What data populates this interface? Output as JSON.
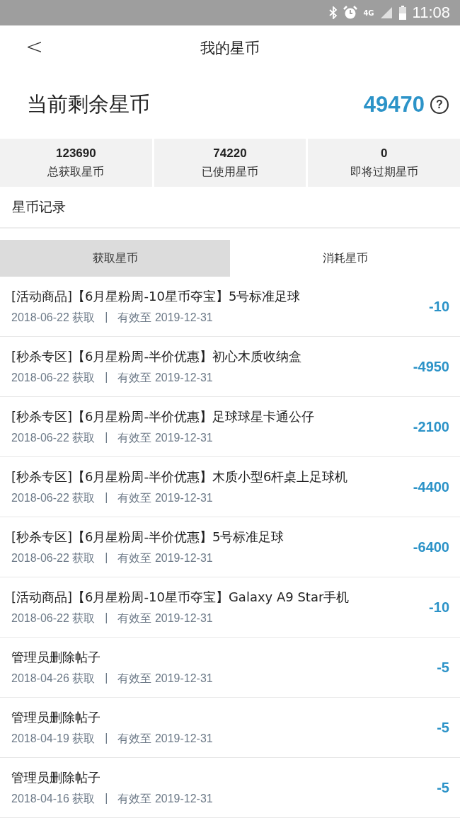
{
  "status_bar": {
    "network": "4G",
    "time": "11:08"
  },
  "header": {
    "back": "<",
    "title": "我的星币"
  },
  "balance": {
    "label": "当前剩余星币",
    "value": "49470",
    "help": "?"
  },
  "stats": [
    {
      "value": "123690",
      "label": "总获取星币"
    },
    {
      "value": "74220",
      "label": "已使用星币"
    },
    {
      "value": "0",
      "label": "即将过期星币"
    }
  ],
  "section_title": "星币记录",
  "tabs": [
    {
      "label": "获取星币",
      "selected": true
    },
    {
      "label": "消耗星币",
      "selected": false
    }
  ],
  "records": [
    {
      "title": "[活动商品]【6月星粉周-10星币夺宝】5号标准足球",
      "date": "2018-06-22 获取",
      "separator": "|",
      "expiry": "有效至 2019-12-31",
      "amount": "-10"
    },
    {
      "title": "[秒杀专区]【6月星粉周-半价优惠】初心木质收纳盒",
      "date": "2018-06-22 获取",
      "separator": "|",
      "expiry": "有效至 2019-12-31",
      "amount": "-4950"
    },
    {
      "title": "[秒杀专区]【6月星粉周-半价优惠】足球球星卡通公仔",
      "date": "2018-06-22 获取",
      "separator": "|",
      "expiry": "有效至 2019-12-31",
      "amount": "-2100"
    },
    {
      "title": "[秒杀专区]【6月星粉周-半价优惠】木质小型6杆桌上足球机",
      "date": "2018-06-22 获取",
      "separator": "|",
      "expiry": "有效至 2019-12-31",
      "amount": "-4400"
    },
    {
      "title": "[秒杀专区]【6月星粉周-半价优惠】5号标准足球",
      "date": "2018-06-22 获取",
      "separator": "|",
      "expiry": "有效至 2019-12-31",
      "amount": "-6400"
    },
    {
      "title": "[活动商品]【6月星粉周-10星币夺宝】Galaxy A9 Star手机",
      "date": "2018-06-22 获取",
      "separator": "|",
      "expiry": "有效至 2019-12-31",
      "amount": "-10"
    },
    {
      "title": "管理员删除帖子",
      "date": "2018-04-26 获取",
      "separator": "|",
      "expiry": "有效至 2019-12-31",
      "amount": "-5"
    },
    {
      "title": "管理员删除帖子",
      "date": "2018-04-19 获取",
      "separator": "|",
      "expiry": "有效至 2019-12-31",
      "amount": "-5"
    },
    {
      "title": "管理员删除帖子",
      "date": "2018-04-16 获取",
      "separator": "|",
      "expiry": "有效至 2019-12-31",
      "amount": "-5"
    }
  ]
}
